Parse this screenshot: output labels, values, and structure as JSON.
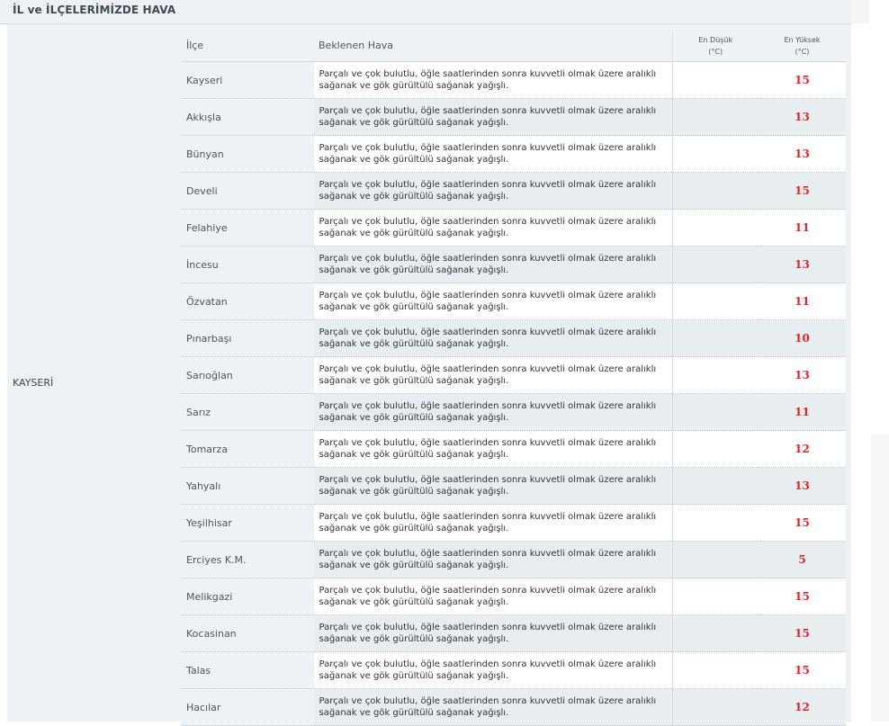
{
  "header": {
    "title": "İL ve İLÇELERİMİZDE HAVA"
  },
  "province": {
    "name": "KAYSERİ"
  },
  "table": {
    "columns": {
      "district": "İlçe",
      "forecast": "Beklenen Hava",
      "min_line1": "En Düşük",
      "min_line2": "(°C)",
      "max_line1": "En Yüksek",
      "max_line2": "(°C)"
    },
    "rows": [
      {
        "district": "Kayseri",
        "forecast": "Parçalı ve çok bulutlu, öğle saatlerinden sonra kuvvetli olmak üzere aralıklı sağanak ve gök gürültülü sağanak yağışlı.",
        "min": "",
        "max": "15"
      },
      {
        "district": "Akkışla",
        "forecast": "Parçalı ve çok bulutlu, öğle saatlerinden sonra kuvvetli olmak üzere aralıklı sağanak ve gök gürültülü sağanak yağışlı.",
        "min": "",
        "max": "13"
      },
      {
        "district": "Bünyan",
        "forecast": "Parçalı ve çok bulutlu, öğle saatlerinden sonra kuvvetli olmak üzere aralıklı sağanak ve gök gürültülü sağanak yağışlı.",
        "min": "",
        "max": "13"
      },
      {
        "district": "Develi",
        "forecast": "Parçalı ve çok bulutlu, öğle saatlerinden sonra kuvvetli olmak üzere aralıklı sağanak ve gök gürültülü sağanak yağışlı.",
        "min": "",
        "max": "15"
      },
      {
        "district": "Felahiye",
        "forecast": "Parçalı ve çok bulutlu, öğle saatlerinden sonra kuvvetli olmak üzere aralıklı sağanak ve gök gürültülü sağanak yağışlı.",
        "min": "",
        "max": "11"
      },
      {
        "district": "İncesu",
        "forecast": "Parçalı ve çok bulutlu, öğle saatlerinden sonra kuvvetli olmak üzere aralıklı sağanak ve gök gürültülü sağanak yağışlı.",
        "min": "",
        "max": "13"
      },
      {
        "district": "Özvatan",
        "forecast": "Parçalı ve çok bulutlu, öğle saatlerinden sonra kuvvetli olmak üzere aralıklı sağanak ve gök gürültülü sağanak yağışlı.",
        "min": "",
        "max": "11"
      },
      {
        "district": "Pınarbaşı",
        "forecast": "Parçalı ve çok bulutlu, öğle saatlerinden sonra kuvvetli olmak üzere aralıklı sağanak ve gök gürültülü sağanak yağışlı.",
        "min": "",
        "max": "10"
      },
      {
        "district": "Sarıoğlan",
        "forecast": "Parçalı ve çok bulutlu, öğle saatlerinden sonra kuvvetli olmak üzere aralıklı sağanak ve gök gürültülü sağanak yağışlı.",
        "min": "",
        "max": "13"
      },
      {
        "district": "Sarız",
        "forecast": "Parçalı ve çok bulutlu, öğle saatlerinden sonra kuvvetli olmak üzere aralıklı sağanak ve gök gürültülü sağanak yağışlı.",
        "min": "",
        "max": "11"
      },
      {
        "district": "Tomarza",
        "forecast": "Parçalı ve çok bulutlu, öğle saatlerinden sonra kuvvetli olmak üzere aralıklı sağanak ve gök gürültülü sağanak yağışlı.",
        "min": "",
        "max": "12"
      },
      {
        "district": "Yahyalı",
        "forecast": "Parçalı ve çok bulutlu, öğle saatlerinden sonra kuvvetli olmak üzere aralıklı sağanak ve gök gürültülü sağanak yağışlı.",
        "min": "",
        "max": "13"
      },
      {
        "district": "Yeşilhisar",
        "forecast": "Parçalı ve çok bulutlu, öğle saatlerinden sonra kuvvetli olmak üzere aralıklı sağanak ve gök gürültülü sağanak yağışlı.",
        "min": "",
        "max": "15"
      },
      {
        "district": "Erciyes K.M.",
        "forecast": "Parçalı ve çok bulutlu, öğle saatlerinden sonra kuvvetli olmak üzere aralıklı sağanak ve gök gürültülü sağanak yağışlı.",
        "min": "",
        "max": "5"
      },
      {
        "district": "Melikgazi",
        "forecast": "Parçalı ve çok bulutlu, öğle saatlerinden sonra kuvvetli olmak üzere aralıklı sağanak ve gök gürültülü sağanak yağışlı.",
        "min": "",
        "max": "15"
      },
      {
        "district": "Kocasinan",
        "forecast": "Parçalı ve çok bulutlu, öğle saatlerinden sonra kuvvetli olmak üzere aralıklı sağanak ve gök gürültülü sağanak yağışlı.",
        "min": "",
        "max": "15"
      },
      {
        "district": "Talas",
        "forecast": "Parçalı ve çok bulutlu, öğle saatlerinden sonra kuvvetli olmak üzere aralıklı sağanak ve gök gürültülü sağanak yağışlı.",
        "min": "",
        "max": "15"
      },
      {
        "district": "Hacılar",
        "forecast": "Parçalı ve çok bulutlu, öğle saatlerinden sonra kuvvetli olmak üzere aralıklı sağanak ve gök gürültülü sağanak yağışlı.",
        "min": "",
        "max": "12"
      }
    ]
  },
  "colors": {
    "max_temp": "#d9262b",
    "header_bg": "#eef2f4",
    "alt_row_bg": "#e8edf0"
  }
}
